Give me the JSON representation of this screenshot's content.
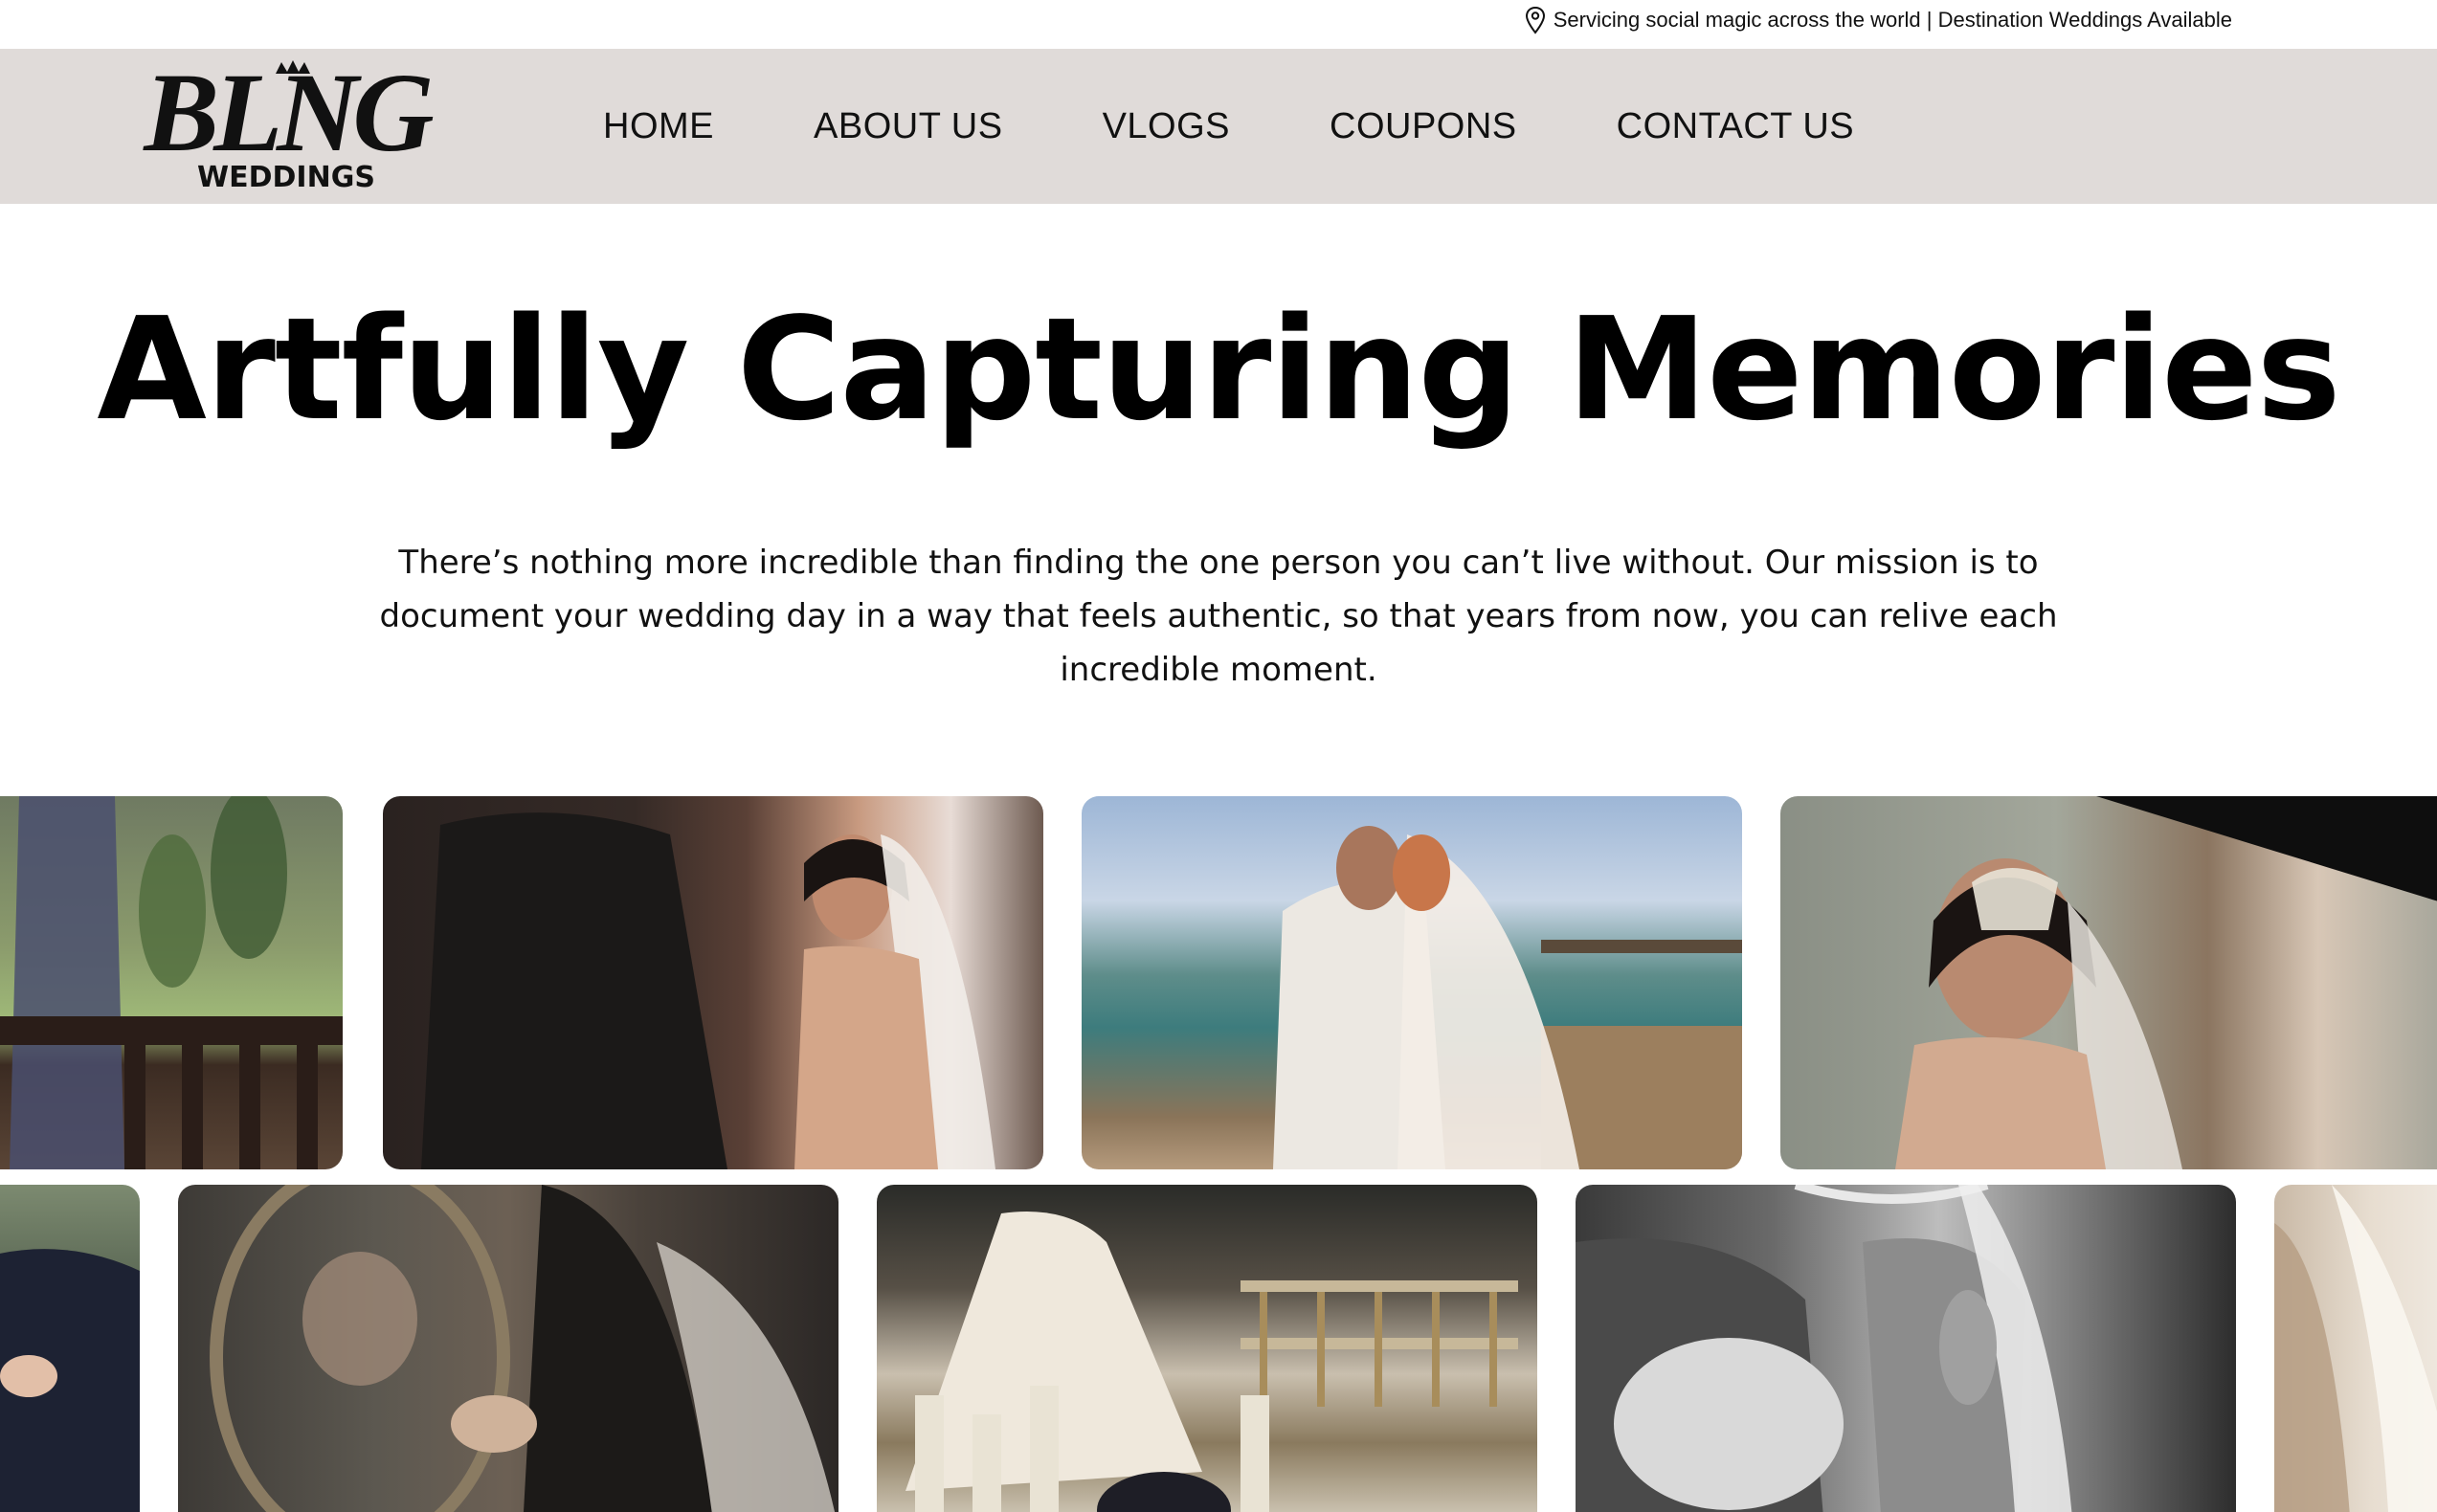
{
  "topbar": {
    "icon": "map-pin-icon",
    "text": "Servicing social magic across the world | Destination Weddings Available"
  },
  "header": {
    "logo": {
      "wordmark": "BLING",
      "subtitle": "WEDDINGS"
    },
    "nav": [
      {
        "label": "HOME"
      },
      {
        "label": "ABOUT US"
      },
      {
        "label": "VLOGS"
      },
      {
        "label": "COUPONS"
      },
      {
        "label": "CONTACT US"
      }
    ],
    "background": "#e0dbd9"
  },
  "hero": {
    "title": "Artfully Capturing Memories",
    "subtitle": "There’s nothing more incredible than finding the one person you can’t live without. Our mission is to document your wedding day in a way that feels authentic, so that years from now, you can relive each incredible moment."
  },
  "gallery": {
    "rows": 2,
    "photos": [
      {
        "row": 1,
        "subject": "bride-at-garden-balcony"
      },
      {
        "row": 1,
        "subject": "bride-and-groom-evening"
      },
      {
        "row": 1,
        "subject": "couple-at-sea-pier"
      },
      {
        "row": 1,
        "subject": "bride-portrait-crown"
      },
      {
        "row": 2,
        "subject": "couple-embrace-outdoors"
      },
      {
        "row": 2,
        "subject": "bride-mirror-getting-ready"
      },
      {
        "row": 2,
        "subject": "bridal-gown-reception-table"
      },
      {
        "row": 2,
        "subject": "bride-black-and-white-detail"
      },
      {
        "row": 2,
        "subject": "bridal-veil-detail"
      }
    ]
  }
}
